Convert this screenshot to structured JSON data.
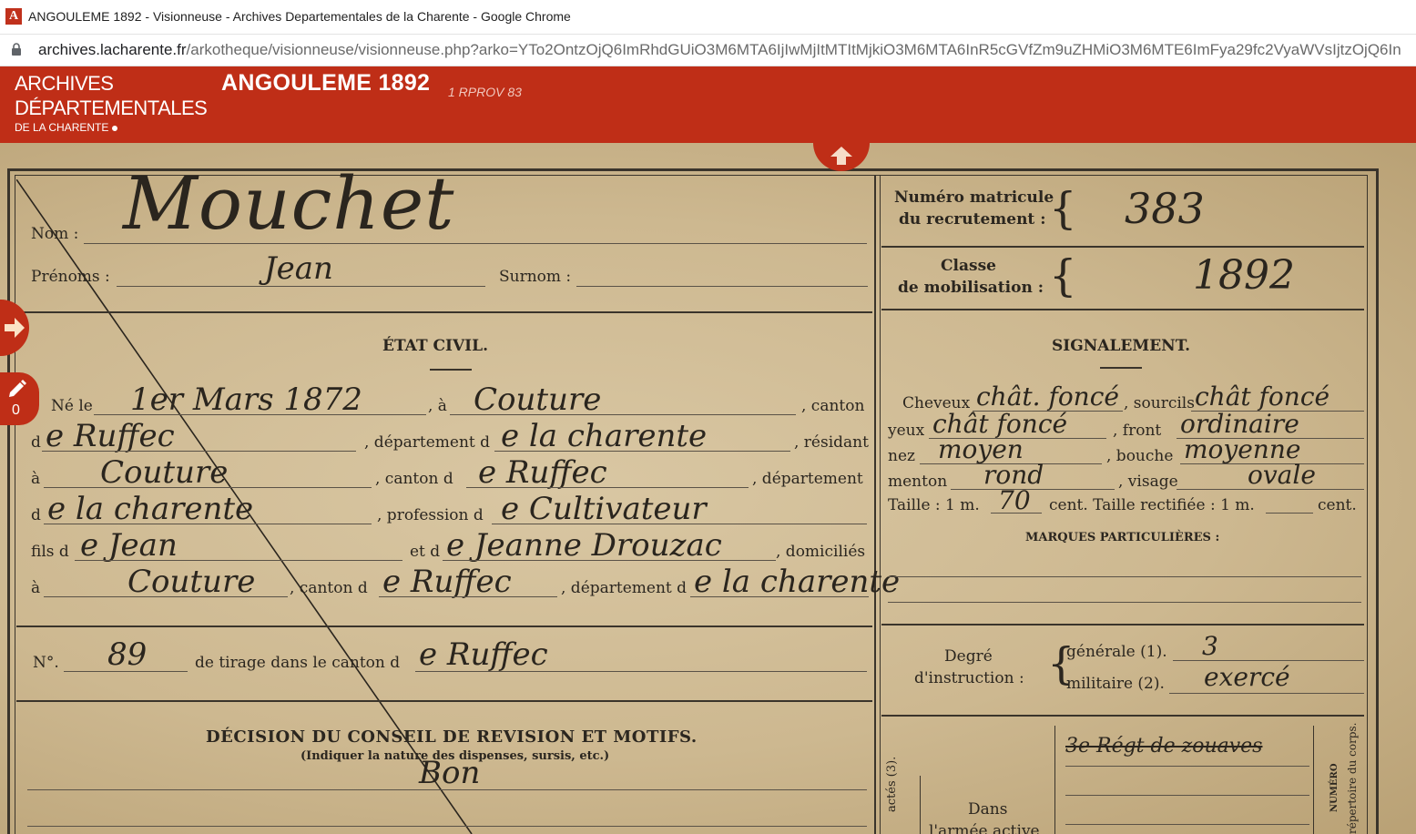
{
  "browser": {
    "window_title": "ANGOULEME 1892 - Visionneuse - Archives Departementales de la Charente - Google Chrome",
    "url_host": "archives.lacharente.fr",
    "url_path": "/arkotheque/visionneuse/visionneuse.php?arko=YTo2OntzOjQ6ImRhdGUiO3M6MTA6IjIwMjItMTItMjkiO3M6MTA6InR5cGVfZm9uZHMiO3M6MTE6ImFya29fc2VyaWVsIjtzOjQ6In"
  },
  "header": {
    "logo_line1": "ARCHIVES",
    "logo_line2": "DÉPARTEMENTALES",
    "logo_line3": "DE LA CHARENTE",
    "title": "ANGOULEME 1892",
    "cote": "1 RPROV 83"
  },
  "viewer": {
    "note_count": "0"
  },
  "document": {
    "labels": {
      "nom": "Nom :",
      "prenoms": "Prénoms :",
      "surnom": "Surnom :",
      "etat_civil": "ÉTAT CIVIL.",
      "ne_le": "Né le",
      "a1": ", à",
      "canton1": ", canton",
      "d1": "d",
      "departement_d": ", département d",
      "residant": ", résidant",
      "a2": "à",
      "canton_d": ", canton d",
      "departement": ", département",
      "d2": "d",
      "profession_d": ", profession d",
      "fils_d": "fils d",
      "et_d": "et d",
      "domicilies": ", domiciliés",
      "a3": "à",
      "canton_d2": ", canton d",
      "departement_d2": ", département d",
      "numero": "N°.",
      "tirage": "de tirage dans le canton d",
      "decision": "DÉCISION DU CONSEIL DE REVISION ET MOTIFS.",
      "decision_sub": "(Indiquer la nature des dispenses, sursis, etc.)",
      "matricule": "Numéro matricule",
      "matricule2": "du recrutement :",
      "classe": "Classe",
      "classe2": "de mobilisation :",
      "signalement": "SIGNALEMENT.",
      "cheveux": "Cheveux",
      "sourcils": ", sourcils",
      "yeux": "yeux",
      "front": ", front",
      "nez": "nez",
      "bouche": ", bouche",
      "menton": "menton",
      "visage": ", visage",
      "taille": "Taille : 1 m.",
      "cent_taille": "cent. Taille rectifiée : 1 m.",
      "cent": "cent.",
      "marques": "MARQUES PARTICULIÈRES :",
      "degre": "Degré",
      "instruction": "d'instruction :",
      "generale": "générale (1).",
      "militaire": "militaire (2).",
      "dans": "Dans",
      "armee_active": "l'armée active",
      "numero_vert": "NUMÉRO",
      "repertoire": "répertoire du corps.",
      "actes": "actés (3)."
    },
    "handwritten": {
      "nom": "Mouchet",
      "prenoms": "Jean",
      "date_naissance": "1er Mars 1872",
      "lieu": "Couture",
      "canton": "e Ruffec",
      "departement": "e la charente",
      "residence": "Couture",
      "canton_res": "e Ruffec",
      "departement_res": "e la charente",
      "profession": "e Cultivateur",
      "pere": "e Jean",
      "mere": "e Jeanne Drouzac",
      "domicile": "Couture",
      "canton_dom": "e Ruffec",
      "departement_dom": "e la charente",
      "numero_tirage": "89",
      "canton_tirage": "e Ruffec",
      "decision": "Bon",
      "matricule": "383",
      "classe": "1892",
      "cheveux": "chât. foncé",
      "sourcils": "chât foncé",
      "yeux": "chât foncé",
      "front": "ordinaire",
      "nez": "moyen",
      "bouche": "moyenne",
      "menton": "rond",
      "visage": "ovale",
      "taille_cm": "70",
      "generale": "3",
      "militaire": "exercé",
      "regiment": "3e Régt de zouaves"
    }
  }
}
